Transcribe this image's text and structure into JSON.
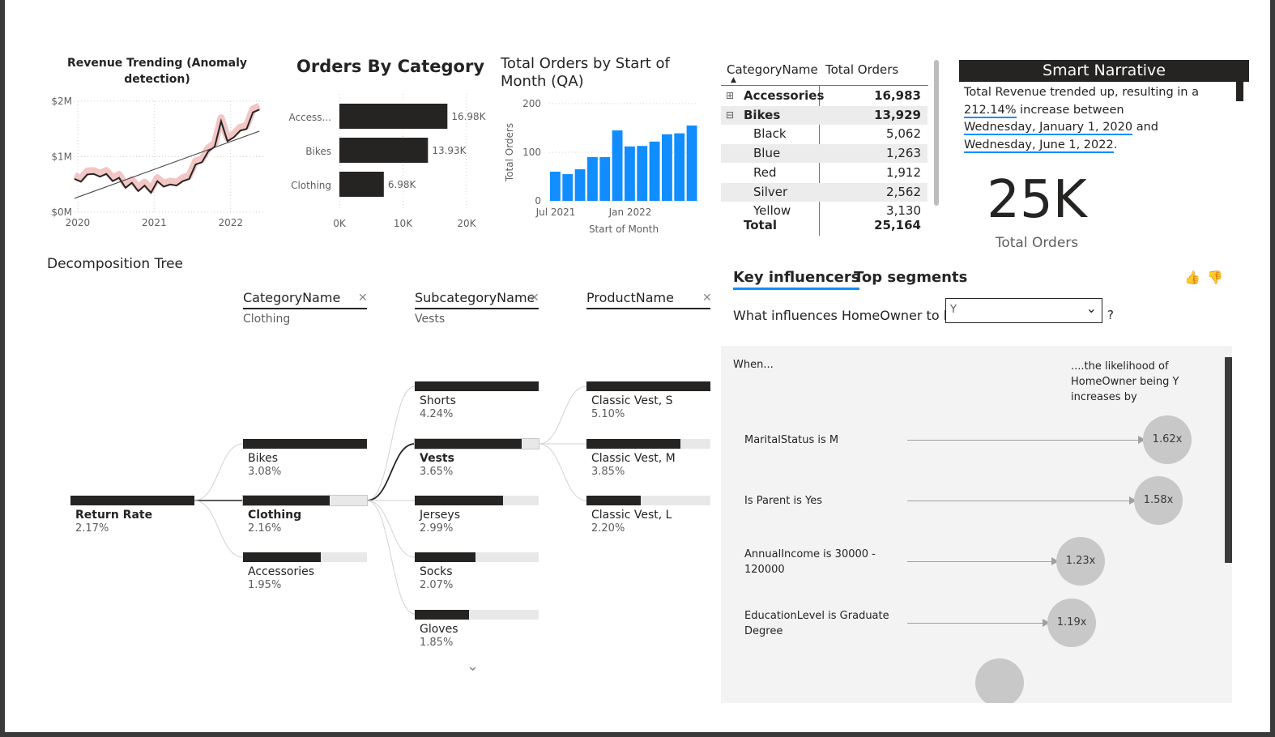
{
  "revenue_chart": {
    "title": "Revenue Trending (Anomaly detection)",
    "chart_data": {
      "type": "line",
      "title": "Revenue Trending (Anomaly detection)",
      "y_ticks": [
        "$0M",
        "$1M",
        "$2M"
      ],
      "x_ticks": [
        "2020",
        "2021",
        "2022"
      ],
      "ylim": [
        0,
        2000000
      ],
      "xlim": [
        0,
        30
      ],
      "series": [
        {
          "x": [
            0,
            1,
            2,
            3,
            4,
            5,
            6,
            7,
            8,
            9,
            10,
            11,
            12,
            13,
            14,
            15,
            16,
            17,
            18,
            19,
            20,
            21,
            22,
            23,
            24,
            25,
            26,
            27,
            28,
            29
          ],
          "values": [
            600000,
            550000,
            680000,
            690000,
            640000,
            690000,
            560000,
            620000,
            440000,
            530000,
            380000,
            480000,
            350000,
            560000,
            460000,
            500000,
            480000,
            560000,
            600000,
            860000,
            900000,
            1100000,
            1180000,
            1640000,
            1280000,
            1350000,
            1470000,
            1500000,
            1800000,
            1850000
          ]
        },
        {
          "x": [
            0,
            29
          ],
          "values": [
            250000,
            1460000
          ]
        }
      ]
    }
  },
  "category_chart": {
    "title": "Orders By Category",
    "chart_data": {
      "type": "bar",
      "orientation": "horizontal",
      "title": "Orders By Category",
      "categories": [
        "Access...",
        "Bikes",
        "Clothing"
      ],
      "values": [
        16983,
        13929,
        6984
      ],
      "data_labels": [
        "16.98K",
        "13.93K",
        "6.98K"
      ],
      "x_ticks": [
        "0K",
        "10K",
        "20K"
      ],
      "xlim": [
        0,
        20000
      ]
    }
  },
  "month_chart": {
    "title": "Total Orders by Start of Month (QA)",
    "chart_data": {
      "type": "bar",
      "title": "Total Orders by Start of Month (QA)",
      "xlabel": "Start of Month",
      "ylabel": "Total Orders",
      "y_ticks": [
        "0",
        "100",
        "200"
      ],
      "x_ticks": [
        "Jul 2021",
        "Jan 2022"
      ],
      "ylim": [
        0,
        200
      ],
      "categories": [
        "Jul 2021",
        "Aug 2021",
        "Sep 2021",
        "Oct 2021",
        "Nov 2021",
        "Dec 2021",
        "Jan 2022",
        "Feb 2022",
        "Mar 2022",
        "Apr 2022",
        "May 2022",
        "Jun 2022"
      ],
      "values": [
        60,
        55,
        65,
        90,
        90,
        145,
        112,
        113,
        122,
        137,
        139,
        155
      ],
      "color": "#118dff"
    }
  },
  "matrix": {
    "col_name": "CategoryName",
    "col_orders": "Total Orders",
    "rows": [
      {
        "name": "Accessories",
        "value": "16,983",
        "bold": true,
        "expander": "⊞"
      },
      {
        "name": "Bikes",
        "value": "13,929",
        "bold": true,
        "expander": "⊟"
      },
      {
        "name": "Black",
        "value": "5,062"
      },
      {
        "name": "Blue",
        "value": "1,263"
      },
      {
        "name": "Red",
        "value": "1,912"
      },
      {
        "name": "Silver",
        "value": "2,562"
      },
      {
        "name": "Yellow",
        "value": "3,130"
      }
    ],
    "total_label": "Total",
    "total_value": "25,164"
  },
  "narrative": {
    "title": "Smart Narrative",
    "line1": "Total Revenue trended up, resulting in a",
    "pct": "212.14%",
    "line2": " increase between",
    "date1": "Wednesday, January 1, 2020",
    "and": " and",
    "date2": "Wednesday, June 1, 2022",
    "period": "."
  },
  "card": {
    "value": "25K",
    "label": "Total Orders"
  },
  "decomp": {
    "title": "Decomposition Tree",
    "levels": [
      {
        "name": "CategoryName",
        "selected": "Clothing"
      },
      {
        "name": "SubcategoryName",
        "selected": "Vests"
      },
      {
        "name": "ProductName",
        "selected": ""
      }
    ],
    "close": "✕",
    "root": {
      "label": "Return Rate",
      "pct": "2.17%",
      "fill": 1.0
    },
    "col1": [
      {
        "label": "Bikes",
        "pct": "3.08%",
        "fill": 1.0
      },
      {
        "label": "Clothing",
        "pct": "2.16%",
        "fill": 0.7
      },
      {
        "label": "Accessories",
        "pct": "1.95%",
        "fill": 0.63
      }
    ],
    "col2": [
      {
        "label": "Shorts",
        "pct": "4.24%",
        "fill": 1.0
      },
      {
        "label": "Vests",
        "pct": "3.65%",
        "fill": 0.86
      },
      {
        "label": "Jerseys",
        "pct": "2.99%",
        "fill": 0.71
      },
      {
        "label": "Socks",
        "pct": "2.07%",
        "fill": 0.49
      },
      {
        "label": "Gloves",
        "pct": "1.85%",
        "fill": 0.44
      }
    ],
    "col3": [
      {
        "label": "Classic Vest, S",
        "pct": "5.10%",
        "fill": 1.0
      },
      {
        "label": "Classic Vest, M",
        "pct": "3.85%",
        "fill": 0.76
      },
      {
        "label": "Classic Vest, L",
        "pct": "2.20%",
        "fill": 0.44
      }
    ],
    "more_icon": "chevron-down-icon"
  },
  "key_influencers": {
    "tab1": "Key influencers",
    "tab2": "Top segments",
    "question": "What influences HomeOwner to be",
    "dropdown_value": "Y",
    "question_mark": "?",
    "when": "When...",
    "likelihood": "....the likelihood of HomeOwner being Y increases by",
    "rows": [
      {
        "label": "MaritalStatus is M",
        "value": "1.62x",
        "ratio": 1.62
      },
      {
        "label": "Is Parent is Yes",
        "value": "1.58x",
        "ratio": 1.58
      },
      {
        "label": "AnnualIncome is 30000 - 120000",
        "value": "1.23x",
        "ratio": 1.23
      },
      {
        "label": "EducationLevel is Graduate Degree",
        "value": "1.19x",
        "ratio": 1.19
      }
    ]
  }
}
